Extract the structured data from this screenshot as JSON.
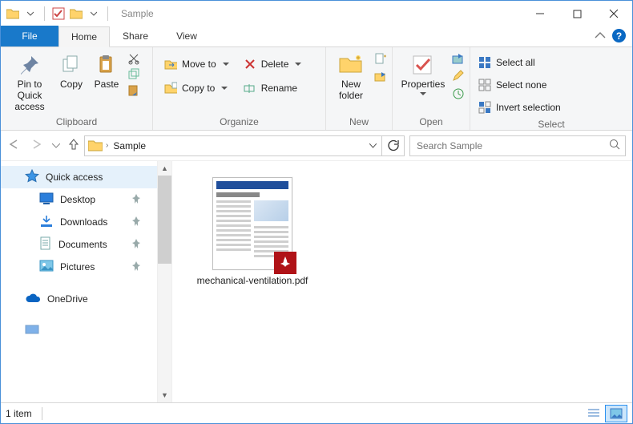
{
  "titlebar": {
    "title": "Sample"
  },
  "tabs": {
    "file": "File",
    "home": "Home",
    "share": "Share",
    "view": "View"
  },
  "ribbon": {
    "clipboard": {
      "label": "Clipboard",
      "pin": "Pin to Quick access",
      "copy": "Copy",
      "paste": "Paste"
    },
    "organize": {
      "label": "Organize",
      "moveto": "Move to",
      "copyto": "Copy to",
      "delete": "Delete",
      "rename": "Rename"
    },
    "new": {
      "label": "New",
      "newfolder": "New folder"
    },
    "open": {
      "label": "Open",
      "properties": "Properties"
    },
    "select": {
      "label": "Select",
      "all": "Select all",
      "none": "Select none",
      "invert": "Invert selection"
    }
  },
  "address": {
    "segments": [
      "Sample"
    ],
    "refresh": "Refresh"
  },
  "search": {
    "placeholder": "Search Sample"
  },
  "sidebar": {
    "items": [
      {
        "label": "Quick access"
      },
      {
        "label": "Desktop"
      },
      {
        "label": "Downloads"
      },
      {
        "label": "Documents"
      },
      {
        "label": "Pictures"
      },
      {
        "label": "OneDrive"
      }
    ]
  },
  "files": {
    "items": [
      {
        "name": "mechanical-ventilation.pdf"
      }
    ]
  },
  "status": {
    "count": "1 item"
  }
}
